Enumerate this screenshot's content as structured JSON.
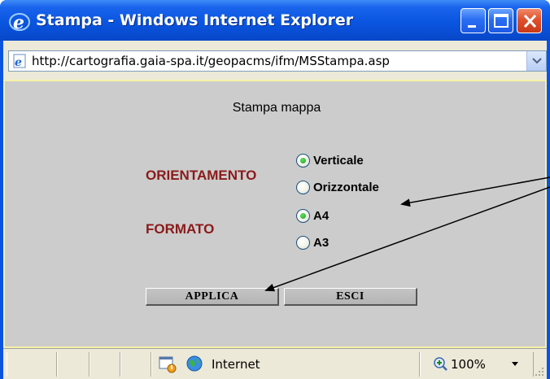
{
  "window": {
    "title": "Stampa - Windows Internet Explorer",
    "url": "http://cartografia.gaia-spa.it/geopacms/ifm/MSStampa.asp"
  },
  "form": {
    "heading": "Stampa mappa",
    "orientation_label": "ORIENTAMENTO",
    "orientation_options": [
      "Verticale",
      "Orizzontale"
    ],
    "orientation_selected": "Verticale",
    "format_label": "FORMATO",
    "format_options": [
      "A4",
      "A3"
    ],
    "format_selected": "A4",
    "apply_label": "APPLICA",
    "exit_label": "ESCI"
  },
  "status": {
    "zone": "Internet",
    "zoom": "100%"
  },
  "colors": {
    "titlebar": "#0a55e0",
    "content_bg": "#cccccc",
    "label_red": "#8b1a1a",
    "content_border": "#f6f1a8"
  },
  "icons": [
    "ie-logo-icon",
    "minimize-icon",
    "maximize-icon",
    "close-icon",
    "page-icon",
    "chevron-down-icon",
    "security-warning-icon",
    "globe-icon",
    "zoom-icon",
    "resize-grip-icon"
  ]
}
